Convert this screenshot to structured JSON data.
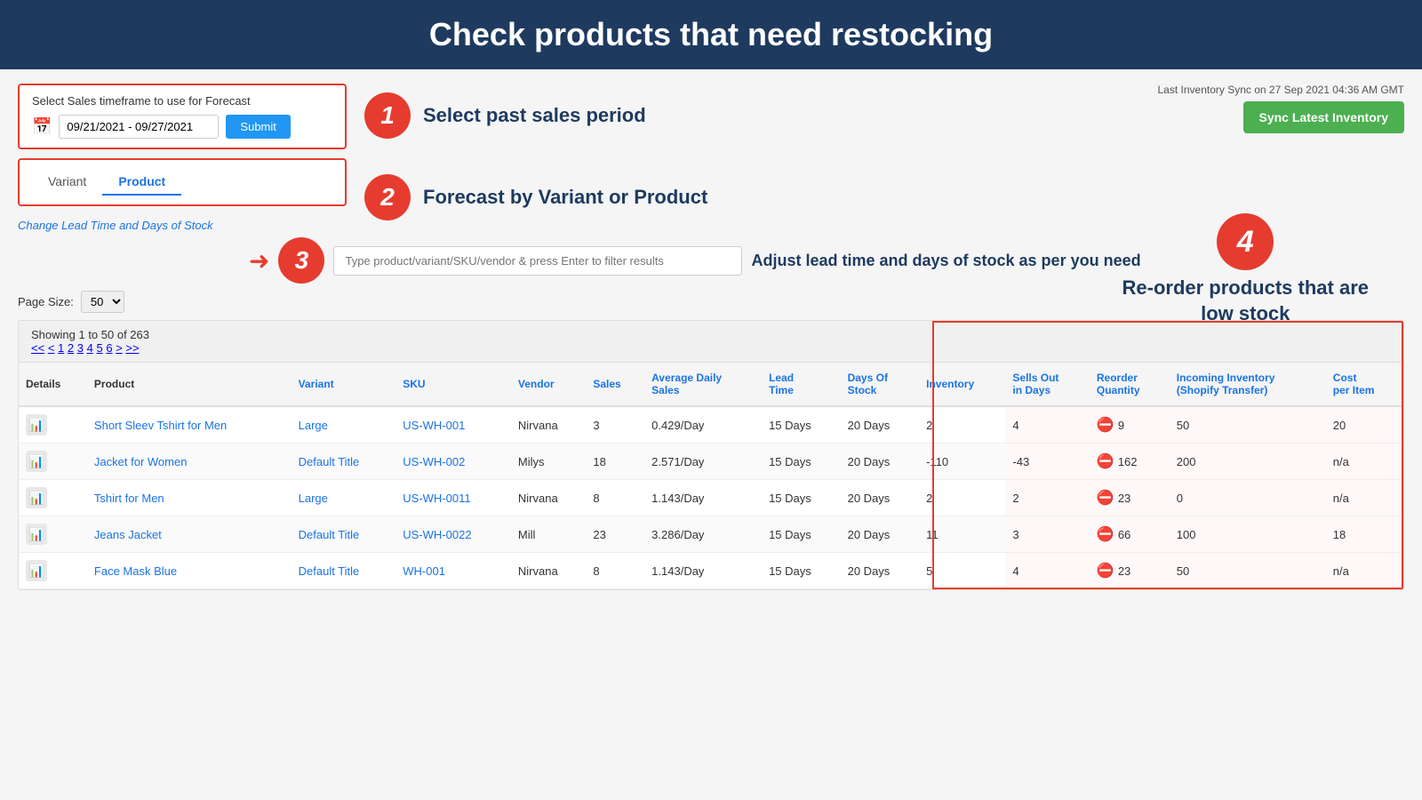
{
  "header": {
    "title": "Check products that need restocking"
  },
  "sync": {
    "label": "Last Inventory Sync on 27 Sep 2021 04:36 AM GMT",
    "button": "Sync Latest Inventory"
  },
  "timeframe": {
    "label": "Select Sales timeframe to use for Forecast",
    "value": "09/21/2021 - 09/27/2021",
    "submit": "Submit"
  },
  "tabs": {
    "variant": "Variant",
    "product": "Product"
  },
  "leadtime_link": "Change Lead Time and Days of Stock",
  "annotations": {
    "step1": "Select past sales period",
    "step2": "Forecast  by Variant or Product",
    "step3": "Adjust lead time and days of stock as per you need",
    "step4_line1": "Re-order products that are",
    "step4_line2": "low stock"
  },
  "search": {
    "placeholder": "Type product/variant/SKU/vendor & press Enter to filter results"
  },
  "page_size": {
    "label": "Page Size:",
    "value": "50"
  },
  "table": {
    "showing": "Showing 1 to 50 of 263",
    "pagination": "<< < 1 2 3 4 5 6 > >>",
    "columns": [
      "Details",
      "Product",
      "Variant",
      "SKU",
      "Vendor",
      "Sales",
      "Average Daily Sales",
      "Lead Time",
      "Days Of Stock",
      "Inventory",
      "Sells Out in Days",
      "Reorder Quantity",
      "Incoming Inventory (Shopify Transfer)",
      "Cost per Item"
    ],
    "rows": [
      {
        "product": "Short Sleev Tshirt for Men",
        "variant": "Large",
        "sku": "US-WH-001",
        "vendor": "Nirvana",
        "sales": "3",
        "avg_daily": "0.429/Day",
        "lead_time": "15 Days",
        "days_stock": "20 Days",
        "inventory": "2",
        "sells_out": "4",
        "reorder": "9",
        "incoming": "50",
        "cost": "20"
      },
      {
        "product": "Jacket for Women",
        "variant": "Default Title",
        "sku": "US-WH-002",
        "vendor": "Milys",
        "sales": "18",
        "avg_daily": "2.571/Day",
        "lead_time": "15 Days",
        "days_stock": "20 Days",
        "inventory": "-110",
        "sells_out": "-43",
        "reorder": "162",
        "incoming": "200",
        "cost": "n/a"
      },
      {
        "product": "Tshirt for Men",
        "variant": "Large",
        "sku": "US-WH-0011",
        "vendor": "Nirvana",
        "sales": "8",
        "avg_daily": "1.143/Day",
        "lead_time": "15 Days",
        "days_stock": "20 Days",
        "inventory": "2",
        "sells_out": "2",
        "reorder": "23",
        "incoming": "0",
        "cost": "n/a"
      },
      {
        "product": "Jeans Jacket",
        "variant": "Default Title",
        "sku": "US-WH-0022",
        "vendor": "Mill",
        "sales": "23",
        "avg_daily": "3.286/Day",
        "lead_time": "15 Days",
        "days_stock": "20 Days",
        "inventory": "11",
        "sells_out": "3",
        "reorder": "66",
        "incoming": "100",
        "cost": "18"
      },
      {
        "product": "Face Mask Blue",
        "variant": "Default Title",
        "sku": "WH-001",
        "vendor": "Nirvana",
        "sales": "8",
        "avg_daily": "1.143/Day",
        "lead_time": "15 Days",
        "days_stock": "20 Days",
        "inventory": "5",
        "sells_out": "4",
        "reorder": "23",
        "incoming": "50",
        "cost": "n/a"
      }
    ]
  }
}
